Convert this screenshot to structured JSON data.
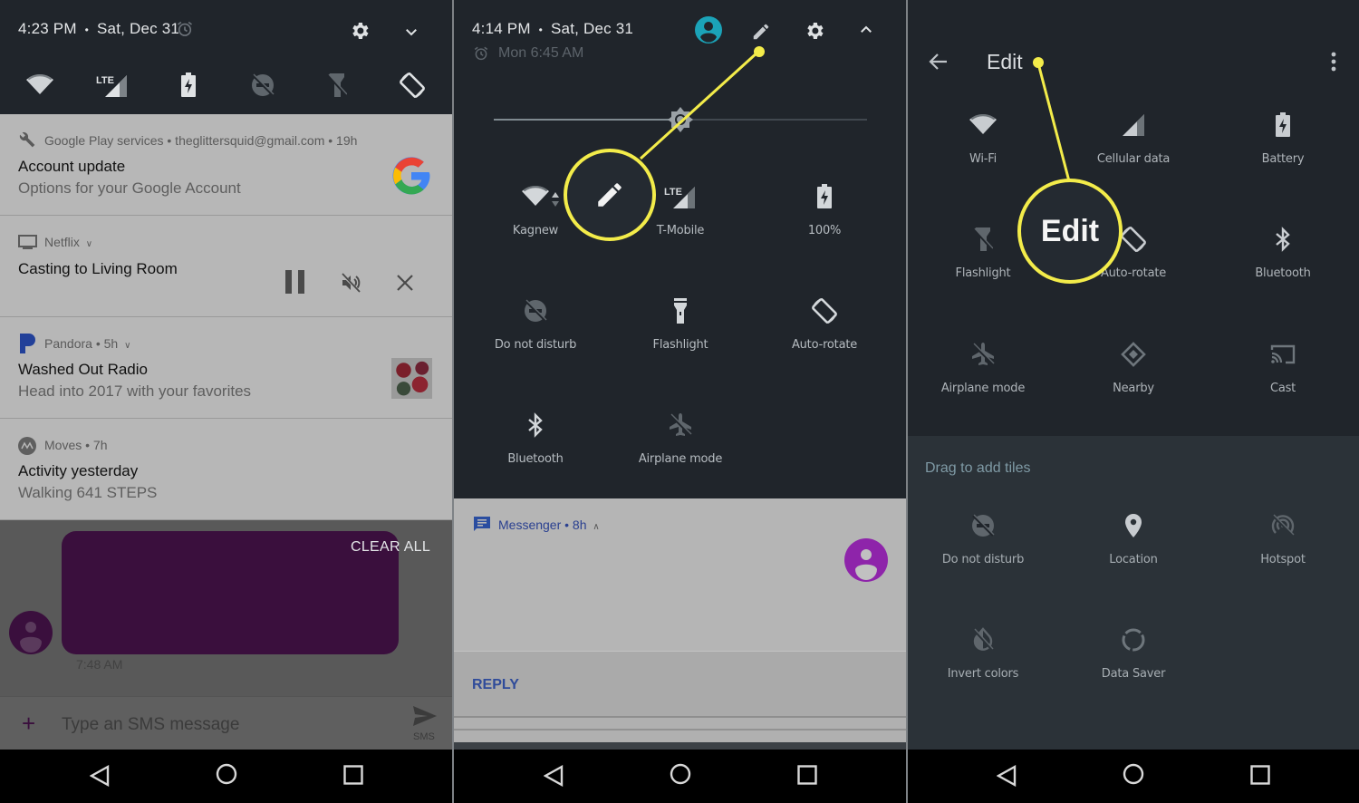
{
  "panel1": {
    "header": {
      "time": "4:23 PM",
      "separator": "•",
      "date": "Sat, Dec 31",
      "icons": [
        "alarm-icon",
        "settings-gear-icon",
        "expand-chevron-down-icon"
      ],
      "quick_toggles": [
        "wifi-icon",
        "lte-signal-icon",
        "battery-charging-icon",
        "do-not-disturb-icon",
        "flashlight-off-icon",
        "auto-rotate-icon"
      ],
      "lte_label": "LTE"
    },
    "notifications": [
      {
        "app": "Google Play services • theglittersquid@gmail.com • 19h",
        "icon": "wrench-icon",
        "title": "Account update",
        "text": "Options for your Google Account",
        "thumbnail": "google-logo"
      },
      {
        "app": "Netflix",
        "icon": "cast-tv-icon",
        "title": "Casting to Living Room",
        "actions": [
          "pause-icon",
          "mute-icon",
          "close-icon"
        ]
      },
      {
        "app": "Pandora • 5h",
        "icon": "pandora-logo",
        "title": "Washed Out Radio",
        "text": "Head into 2017 with your favorites",
        "thumbnail": "album-art"
      },
      {
        "app": "Moves • 7h",
        "icon": "moves-logo",
        "title": "Activity yesterday",
        "text": "Walking 641 STEPS"
      }
    ],
    "clear_all": "CLEAR ALL",
    "sms": {
      "timestamp": "7:48 AM",
      "input_placeholder": "Type an SMS message",
      "send_label": "SMS",
      "bubble_color": "#3a0f3d"
    }
  },
  "panel2": {
    "header": {
      "time": "4:14 PM",
      "separator": "•",
      "date": "Sat, Dec 31",
      "alarm": "Mon 6:45 AM",
      "icons": [
        "user-avatar-icon",
        "edit-pencil-icon",
        "settings-gear-icon",
        "collapse-chevron-up-icon"
      ],
      "lte_label": "LTE"
    },
    "brightness": 0.5,
    "tiles": [
      {
        "label": "Kagnew",
        "icon": "wifi-icon"
      },
      {
        "label": "T-Mobile",
        "icon": "lte-signal-icon"
      },
      {
        "label": "100%",
        "icon": "battery-charging-icon"
      },
      {
        "label": "Do not disturb",
        "icon": "do-not-disturb-icon"
      },
      {
        "label": "Flashlight",
        "icon": "flashlight-icon"
      },
      {
        "label": "Auto-rotate",
        "icon": "auto-rotate-icon"
      },
      {
        "label": "Bluetooth",
        "icon": "bluetooth-icon"
      },
      {
        "label": "Airplane mode",
        "icon": "airplane-mode-icon"
      }
    ],
    "messenger": {
      "app": "Messenger • 8h",
      "reply": "REPLY"
    },
    "accent_color": "#f3ec4a"
  },
  "panel3": {
    "title": "Edit",
    "callout_label": "Edit",
    "active_tiles": [
      {
        "label": "Wi-Fi",
        "icon": "wifi-icon"
      },
      {
        "label": "Cellular data",
        "icon": "cellular-signal-icon"
      },
      {
        "label": "Battery",
        "icon": "battery-charging-icon"
      },
      {
        "label": "Flashlight",
        "icon": "flashlight-off-icon"
      },
      {
        "label": "Auto-rotate",
        "icon": "auto-rotate-icon"
      },
      {
        "label": "Bluetooth",
        "icon": "bluetooth-icon"
      },
      {
        "label": "Airplane mode",
        "icon": "airplane-mode-icon"
      },
      {
        "label": "Nearby",
        "icon": "nearby-icon"
      },
      {
        "label": "Cast",
        "icon": "cast-icon"
      }
    ],
    "drag_header": "Drag to add tiles",
    "available_tiles": [
      {
        "label": "Do not disturb",
        "icon": "do-not-disturb-icon"
      },
      {
        "label": "Location",
        "icon": "location-pin-icon"
      },
      {
        "label": "Hotspot",
        "icon": "hotspot-icon"
      },
      {
        "label": "Invert colors",
        "icon": "invert-colors-icon"
      },
      {
        "label": "Data Saver",
        "icon": "data-saver-icon"
      }
    ]
  },
  "navbar": [
    "back-button",
    "home-button",
    "recents-button"
  ]
}
